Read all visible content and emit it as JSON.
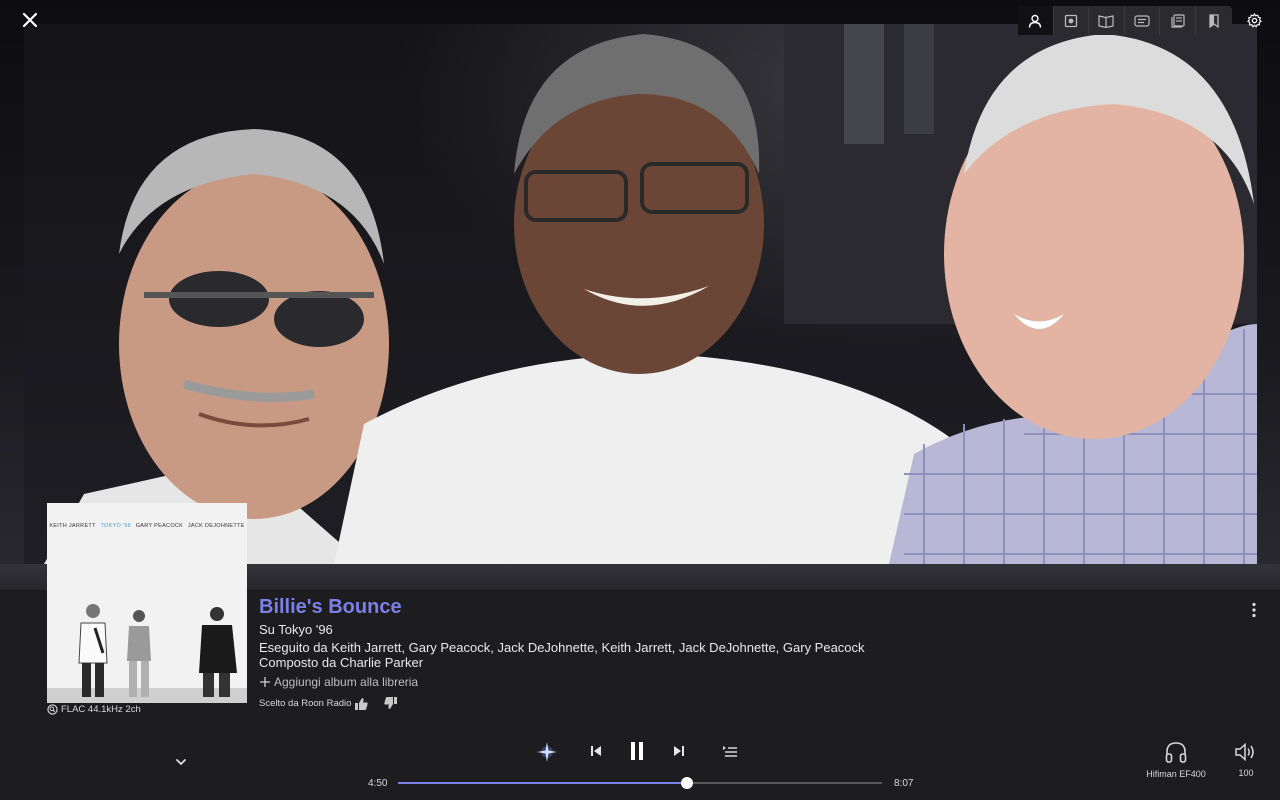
{
  "track": {
    "title": "Billie's Bounce",
    "album_line": "Su Tokyo '96",
    "performers_prefix": "Eseguito da",
    "performers": "Keith Jarrett, Gary Peacock, Jack DeJohnette, Keith Jarrett, Jack DeJohnette, Gary Peacock",
    "composer_prefix": "Composto da",
    "composer": "Charlie Parker",
    "add_album_label": "Aggiungi album alla libreria",
    "format": "FLAC 44.1kHz 2ch",
    "radio_pick": "Scelto da Roon Radio"
  },
  "cover": {
    "artist_1": "KEITH JARRETT",
    "title": "TOKYO '96",
    "artist_2": "GARY PEACOCK",
    "artist_3": "JACK DEJOHNETTE",
    "accent_color": "#4aa3c8"
  },
  "playback": {
    "elapsed": "4:50",
    "total": "8:07",
    "progress": 0.597,
    "accent_color": "#7b7fe6"
  },
  "zone": {
    "name": "Hifiman EF400",
    "volume": "100"
  },
  "toolbar": {
    "icons": [
      "person-icon",
      "speaker-icon",
      "album-notes-icon",
      "lyrics-icon",
      "credits-icon",
      "bookmark-icon"
    ],
    "active_index": 0
  }
}
